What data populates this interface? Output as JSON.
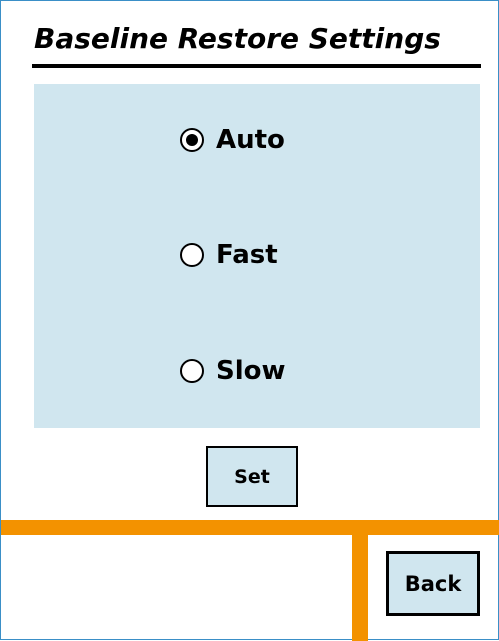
{
  "screen": {
    "title": "Baseline Restore Settings"
  },
  "options": [
    {
      "label": "Auto",
      "selected": true
    },
    {
      "label": "Fast",
      "selected": false
    },
    {
      "label": "Slow",
      "selected": false
    }
  ],
  "buttons": {
    "set_label": "Set",
    "back_label": "Back"
  },
  "colors": {
    "panel_background": "#d0e6ef",
    "accent_orange": "#f39200",
    "frame_border": "#3a8fc7"
  }
}
